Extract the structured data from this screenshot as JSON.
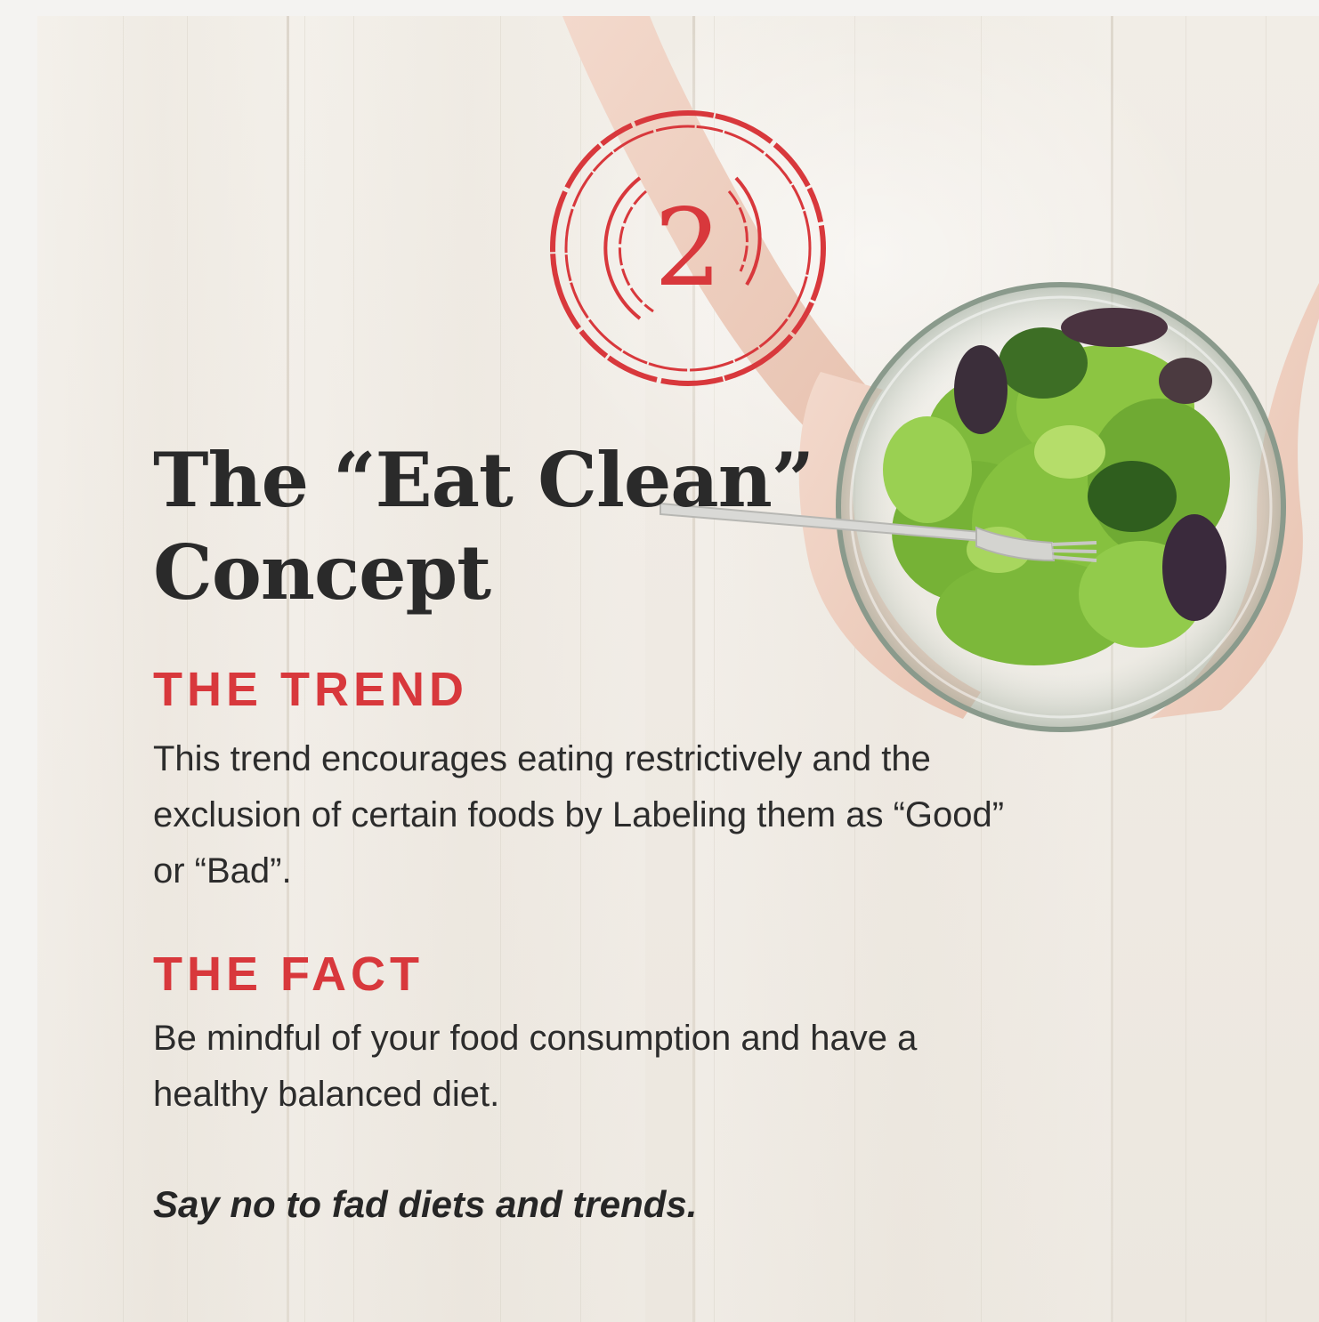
{
  "stamp": {
    "number": "2",
    "color": "#d8383c"
  },
  "title": {
    "line1": "The “Eat Clean”",
    "line2": "Concept"
  },
  "trend": {
    "heading": "THE TREND",
    "body": "This trend encourages eating restrictively and the exclusion of certain foods by Labeling them as “Good” or “Bad”."
  },
  "fact": {
    "heading": "THE FACT",
    "body": "Be mindful of your food consumption and have a healthy balanced diet."
  },
  "tagline": "Say no to fad diets and trends.",
  "colors": {
    "accent": "#d8383c",
    "text": "#2a2a2a",
    "background": "#efeae3"
  }
}
